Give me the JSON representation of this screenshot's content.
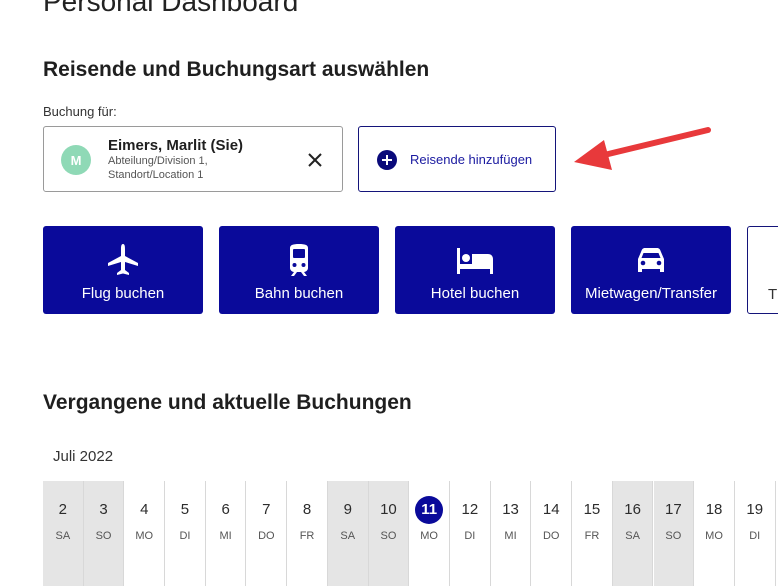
{
  "page": {
    "title": "Personal Dashboard"
  },
  "travelers_section": {
    "title": "Reisende und Buchungsart auswählen",
    "booking_for_label": "Buchung für:",
    "traveler": {
      "initial": "M",
      "name": "Eimers, Marlit (Sie)",
      "detail_line_1": "Abteilung/Division 1,",
      "detail_line_2": "Standort/Location 1"
    },
    "add_traveler_label": "Reisende hinzufügen"
  },
  "booking_types": [
    {
      "icon": "airplane-icon",
      "label": "Flug buchen"
    },
    {
      "icon": "train-icon",
      "label": "Bahn buchen"
    },
    {
      "icon": "bed-icon",
      "label": "Hotel buchen"
    },
    {
      "icon": "car-icon",
      "label": "Mietwagen/Transfer"
    },
    {
      "label": "T"
    }
  ],
  "bookings_section": {
    "title": "Vergangene und aktuelle Buchungen",
    "month": "Juli 2022",
    "days": [
      {
        "num": "2",
        "abbr": "SA",
        "weekend": true
      },
      {
        "num": "3",
        "abbr": "SO",
        "weekend": true
      },
      {
        "num": "4",
        "abbr": "MO"
      },
      {
        "num": "5",
        "abbr": "DI"
      },
      {
        "num": "6",
        "abbr": "MI"
      },
      {
        "num": "7",
        "abbr": "DO"
      },
      {
        "num": "8",
        "abbr": "FR"
      },
      {
        "num": "9",
        "abbr": "SA",
        "weekend": true
      },
      {
        "num": "10",
        "abbr": "SO",
        "weekend": true
      },
      {
        "num": "11",
        "abbr": "MO",
        "today": true
      },
      {
        "num": "12",
        "abbr": "DI"
      },
      {
        "num": "13",
        "abbr": "MI"
      },
      {
        "num": "14",
        "abbr": "DO"
      },
      {
        "num": "15",
        "abbr": "FR"
      },
      {
        "num": "16",
        "abbr": "SA",
        "weekend": true
      },
      {
        "num": "17",
        "abbr": "SO",
        "weekend": true
      },
      {
        "num": "18",
        "abbr": "MO"
      },
      {
        "num": "19",
        "abbr": "DI"
      }
    ]
  },
  "colors": {
    "primary": "#0a0a9a",
    "annotation_arrow": "#e8393b",
    "avatar": "#8fd9b6",
    "weekend_bg": "#e5e5e5"
  }
}
